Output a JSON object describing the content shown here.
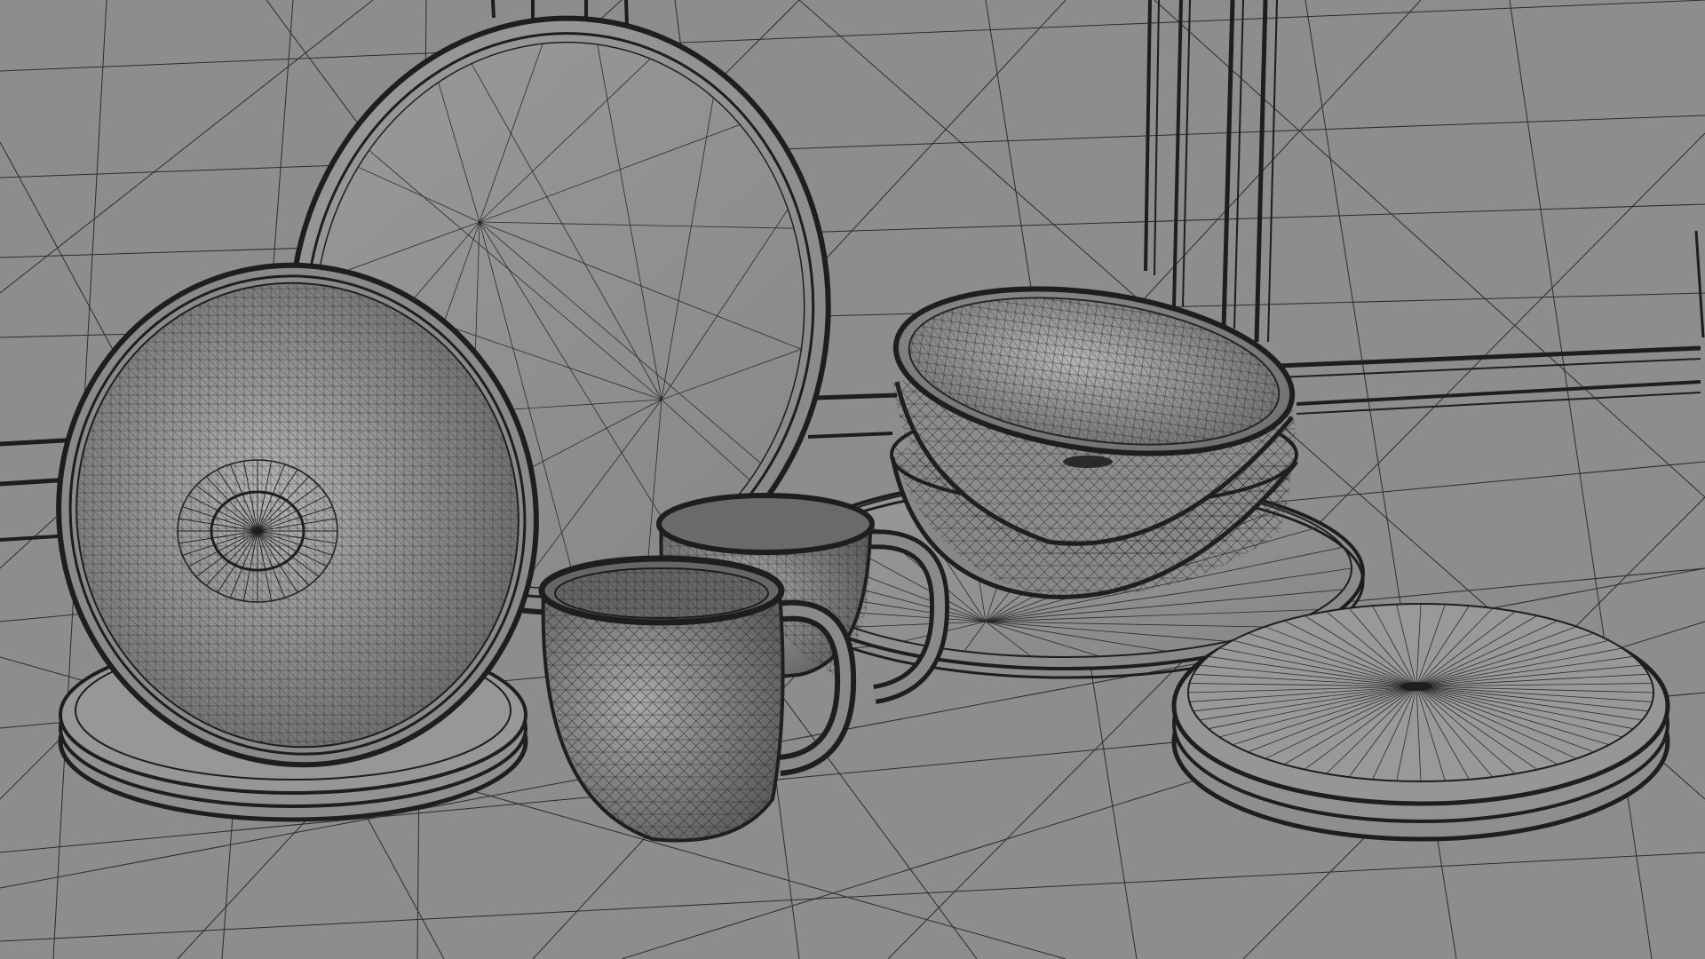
{
  "scene": {
    "description_type": "wireframe-render",
    "background_color": "#8d8d8d",
    "wire_color": "#1e1e1e",
    "shade_light": "#bdbdbd",
    "shade_dark": "#5a5a5a",
    "objects": [
      "dinner-plate-upright",
      "tilted-bowl",
      "plate-stack-left",
      "mug-front",
      "mug-back",
      "bowl-stack",
      "dinner-plate-flat",
      "plate-stack-right",
      "rack-posts"
    ]
  }
}
